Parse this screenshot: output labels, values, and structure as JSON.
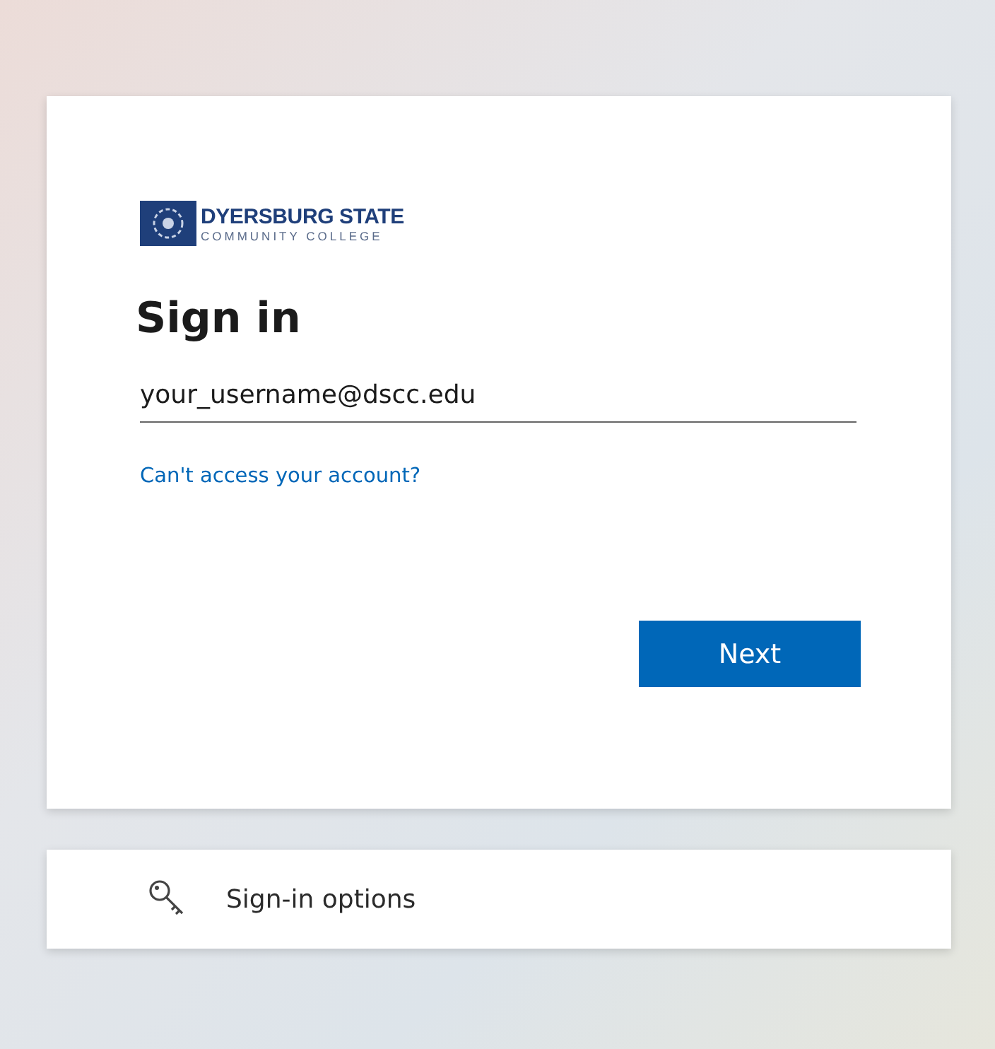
{
  "logo": {
    "line_1": "DYERSBURG STATE",
    "line_2": "COMMUNITY COLLEGE"
  },
  "heading": "Sign in",
  "email_field": {
    "value": "your_username@dscc.edu"
  },
  "help_link": "Can't access your account?",
  "next_button": "Next",
  "options_button": "Sign-in options"
}
